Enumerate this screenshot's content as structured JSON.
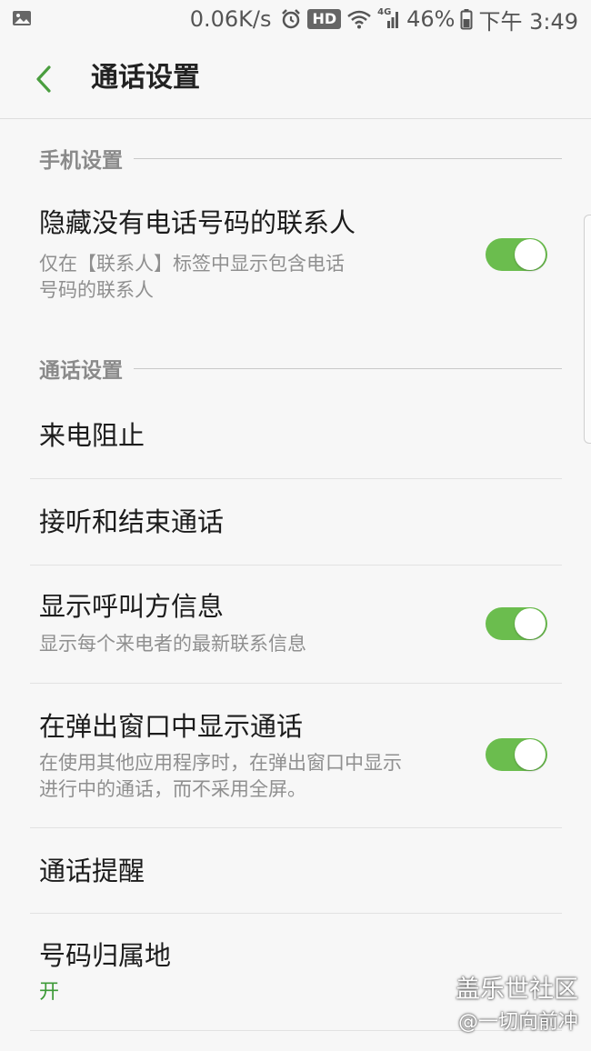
{
  "status_bar": {
    "net_speed": "0.06K/s",
    "hd_badge": "HD",
    "network_type": "4G",
    "battery_percent": "46%",
    "time": "下午 3:49",
    "icons": [
      "gallery-icon",
      "alarm-icon",
      "wifi-icon",
      "signal-icon",
      "battery-icon"
    ]
  },
  "header": {
    "title": "通话设置",
    "back_icon": "chevron-left-icon"
  },
  "sections": {
    "phone": {
      "label": "手机设置",
      "hide_contacts": {
        "title": "隐藏没有电话号码的联系人",
        "summary_line1": "仅在【联系人】标签中显示包含电话",
        "summary_line2": "号码的联系人",
        "enabled": true
      }
    },
    "call": {
      "label": "通话设置",
      "call_blocking": {
        "title": "来电阻止"
      },
      "answer_end": {
        "title": "接听和结束通话"
      },
      "caller_info": {
        "title": "显示呼叫方信息",
        "summary": "显示每个来电者的最新联系信息",
        "enabled": true
      },
      "popup_call": {
        "title": "在弹出窗口中显示通话",
        "summary_line1": "在使用其他应用程序时，在弹出窗口中显示",
        "summary_line2": "进行中的通话，而不采用全屏。",
        "enabled": true
      },
      "call_reminder": {
        "title": "通话提醒"
      },
      "number_location": {
        "title": "号码归属地",
        "value": "开"
      }
    }
  },
  "watermark": {
    "line1": "盖乐世社区",
    "line2": "@一切向前冲"
  },
  "colors": {
    "accent_green": "#6bbd4e",
    "value_green": "#3d9a37",
    "background": "#f7f7f7",
    "section_label": "#8a8a8a"
  }
}
